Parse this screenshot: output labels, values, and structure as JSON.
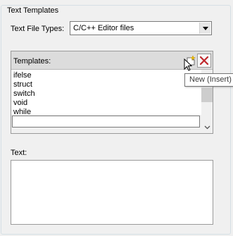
{
  "group": {
    "title": "Text Templates"
  },
  "file_types": {
    "label": "Text File Types:",
    "selected": "C/C++ Editor files"
  },
  "templates": {
    "header_label": "Templates:",
    "items": [
      "ifelse",
      "struct",
      "switch",
      "void",
      "while"
    ],
    "name_value": ""
  },
  "toolbar": {
    "new_icon": "new-document-star-icon",
    "delete_icon": "red-x-delete-icon",
    "delete_color": "#c0282d"
  },
  "tooltip": {
    "text": "New (Insert)"
  },
  "text_section": {
    "label": "Text:",
    "value": ""
  }
}
